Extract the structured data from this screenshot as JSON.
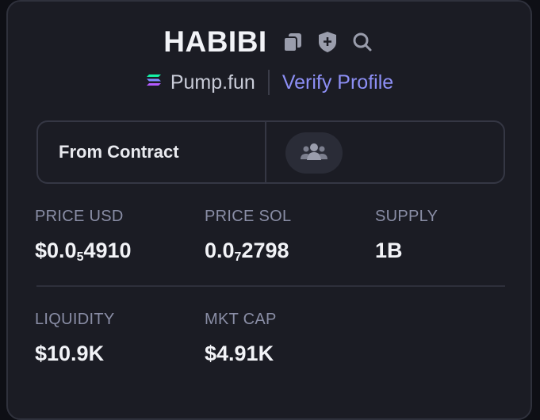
{
  "token": {
    "name": "HABIBI"
  },
  "header": {
    "platform": "Pump.fun",
    "verify_label": "Verify Profile"
  },
  "contract": {
    "label": "From Contract"
  },
  "stats": {
    "price_usd": {
      "label": "PRICE USD",
      "prefix": "$0.0",
      "zeros": "5",
      "digits": "4910"
    },
    "price_sol": {
      "label": "PRICE SOL",
      "prefix": "0.0",
      "zeros": "7",
      "digits": "2798"
    },
    "supply": {
      "label": "SUPPLY",
      "value": "1B"
    },
    "liquidity": {
      "label": "LIQUIDITY",
      "value": "$10.9K"
    },
    "mkt_cap": {
      "label": "MKT CAP",
      "value": "$4.91K"
    }
  },
  "icons": {
    "copy": "copy-icon",
    "shield": "shield-icon",
    "search": "search-icon",
    "platform_logo": "solana-logo-icon",
    "community": "users-icon"
  },
  "colors": {
    "accent": "#8d8ff5",
    "background": "#1b1c24",
    "label": "#8a8ea6"
  }
}
